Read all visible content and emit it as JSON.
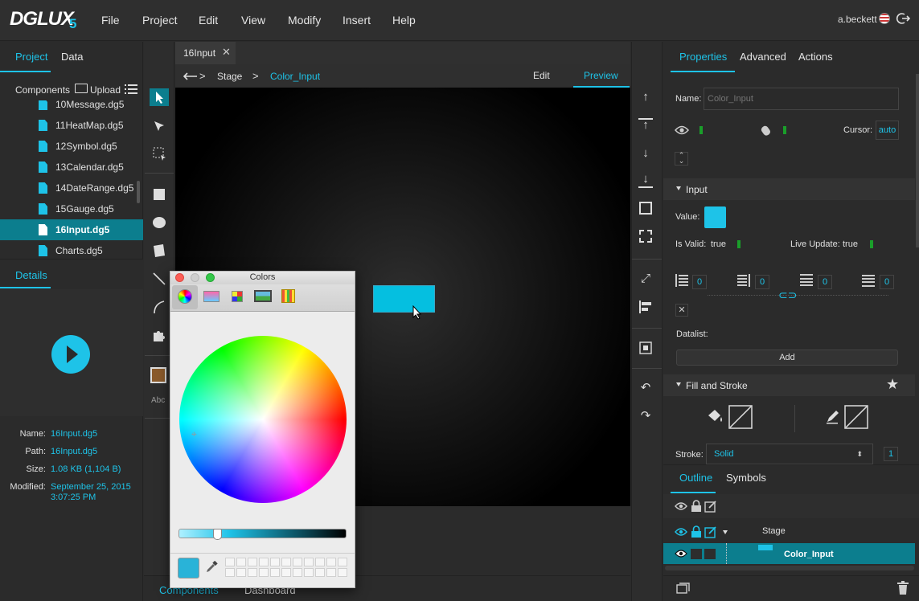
{
  "app": {
    "logo_text": "DGLUX",
    "logo_version": "5",
    "menu": [
      "File",
      "Project",
      "Edit",
      "View",
      "Modify",
      "Insert",
      "Help"
    ],
    "user": "a.beckett"
  },
  "left_panel": {
    "tabs": [
      "Project",
      "Data"
    ],
    "components_label": "Components",
    "upload_label": "Upload",
    "files": [
      "10Message.dg5",
      "11HeatMap.dg5",
      "12Symbol.dg5",
      "13Calendar.dg5",
      "14DateRange.dg5",
      "15Gauge.dg5",
      "16Input.dg5",
      "Charts.dg5"
    ],
    "selected_file": "16Input.dg5",
    "details_tab": "Details",
    "details": {
      "name_label": "Name:",
      "name": "16Input.dg5",
      "path_label": "Path:",
      "path": "16Input.dg5",
      "size_label": "Size:",
      "size": "1.08 KB (1,104 B)",
      "modified_label": "Modified:",
      "modified_date": "September 25, 2015",
      "modified_time": "3:07:25 PM"
    }
  },
  "center": {
    "doc_tab": "16Input",
    "breadcrumb": [
      "Stage",
      "Color_Input"
    ],
    "breadcrumb_sep": ">",
    "mode_edit": "Edit",
    "mode_preview": "Preview",
    "bottom_tabs": [
      "Components",
      "Dashboard"
    ],
    "tool_text_label": "Abc"
  },
  "color_picker": {
    "title": "Colors",
    "current_color": "#29b3d8"
  },
  "right_panel": {
    "tabs": [
      "Properties",
      "Advanced",
      "Actions"
    ],
    "name_label": "Name:",
    "name_placeholder": "Color_Input",
    "cursor_label": "Cursor:",
    "cursor_value": "auto",
    "section_input": "Input",
    "value_label": "Value:",
    "value_color": "#1ec3e8",
    "is_valid_label": "Is Valid:",
    "is_valid_value": "true",
    "live_update_label": "Live Update:",
    "live_update_value": "true",
    "padding_values": [
      "0",
      "0",
      "0",
      "0"
    ],
    "datalist_label": "Datalist:",
    "add_label": "Add",
    "section_fill": "Fill and Stroke",
    "stroke_label": "Stroke:",
    "stroke_value": "Solid",
    "stroke_width": "1",
    "outline_tabs": [
      "Outline",
      "Symbols"
    ],
    "outline_rows": [
      "Stage",
      "Color_Input"
    ]
  },
  "colors": {
    "accent": "#1ec3e8",
    "selected_row": "#0c7e8e"
  }
}
